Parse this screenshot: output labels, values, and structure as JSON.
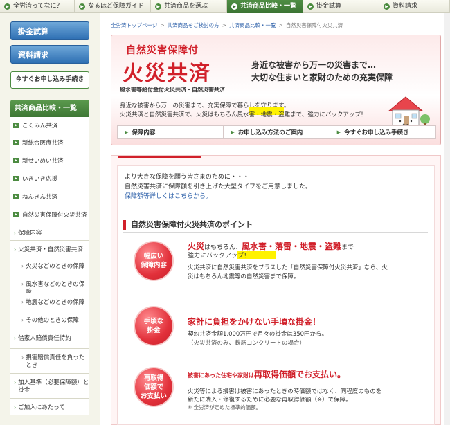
{
  "topnav": [
    {
      "label": "全労済ってなに？",
      "active": false
    },
    {
      "label": "なるほど保障ガイド",
      "active": false
    },
    {
      "label": "共済商品を選ぶ",
      "active": false
    },
    {
      "label": "共済商品比較・一覧",
      "active": true
    },
    {
      "label": "掛金試算",
      "active": false
    },
    {
      "label": "資料請求",
      "active": false
    }
  ],
  "left": {
    "btn_estimate": "掛金試算",
    "btn_request": "資料請求",
    "btn_apply": "今すぐお申し込み手続き",
    "menu_head": "共済商品比較・一覧",
    "menu": [
      {
        "label": "こくみん共済",
        "level": 0
      },
      {
        "label": "新総合医療共済",
        "level": 0
      },
      {
        "label": "新せいめい共済",
        "level": 0
      },
      {
        "label": "いきいき応援",
        "level": 0
      },
      {
        "label": "ねんきん共済",
        "level": 0
      },
      {
        "label": "自然災害保障付火災共済",
        "level": 0
      },
      {
        "label": "保障内容",
        "level": 1
      },
      {
        "label": "火災共済・自然災害共済",
        "level": 1
      },
      {
        "label": "火災などのときの保障",
        "level": 2
      },
      {
        "label": "風水害などのときの保障",
        "level": 2
      },
      {
        "label": "地震などのときの保障",
        "level": 2
      },
      {
        "label": "その他のときの保障",
        "level": 2
      },
      {
        "label": "借家人賠償責任特約",
        "level": 1
      },
      {
        "label": "損害賠償責任を負ったとき",
        "level": 2
      },
      {
        "label": "加入基準（必要保障額）と掛金",
        "level": 1
      },
      {
        "label": "ご加入にあたって",
        "level": 1
      }
    ]
  },
  "breadcrumb": {
    "items": [
      "全労済トップページ",
      "共済商品をご検討の方",
      "共済商品比較・一覧"
    ],
    "current": "自然災害保障付火災共済"
  },
  "hero": {
    "subtitle": "自然災害保障付",
    "title": "火災共済",
    "tagline": "風水害等給付金付火災共済・自然災害共済",
    "catch1": "身近な被害から万一の災害まで…",
    "catch2": "大切な住まいと家財のための充実保障",
    "desc1": "身近な被害から万一の災害まで、充実保障で暮らしを守ります。",
    "desc2": "火災共済と自然災害共済で、火災はもちろん風水害・地震・盗難まで、強力にバックアップ！",
    "nav": [
      "保障内容",
      "お申し込み方法のご案内",
      "今すぐお申し込み手続き"
    ]
  },
  "intro": {
    "line1": "より大きな保障を願う皆さまのために・・・",
    "line2": "自然災害共済に保障額を引き上げた大型タイプをご用意しました。",
    "link": "保障額等詳しくはこちらから。"
  },
  "section_title": "自然災害保障付火災共済のポイント",
  "points": [
    {
      "badge": [
        "幅広い",
        "保障内容"
      ],
      "head_a": "火災",
      "head_b": "はもちろん、",
      "head_c": "風水害・落雷・地震・盗難",
      "head_d": "まで",
      "head_e": "強力にバックアップ！",
      "body1": "火災共済に自然災害共済をプラスした「自然災害保障付火災共済」なら、火",
      "body2": "災はもちろん地震等の自然災害まで保障。"
    },
    {
      "badge": [
        "手頃な",
        "掛金"
      ],
      "head": "家計に負担をかけない手頃な掛金！",
      "body1": "契約共済金額1,000万円で月々の掛金は350円から。",
      "body2": "（火災共済のみ、鉄筋コンクリートの場合）"
    },
    {
      "badge": [
        "再取得",
        "価額で",
        "お支払い"
      ],
      "head_a": "被害にあった住宅や家財は",
      "head_b": "再取得価額でお支払い。",
      "body1": "火災等による損害は被害にあったときの時価額ではなく、同程度のものを",
      "body2": "新たに購入・修復するために必要な再取得価額（※）で保障。",
      "body3": "※ 全労済が定めた標準的価額。"
    }
  ]
}
